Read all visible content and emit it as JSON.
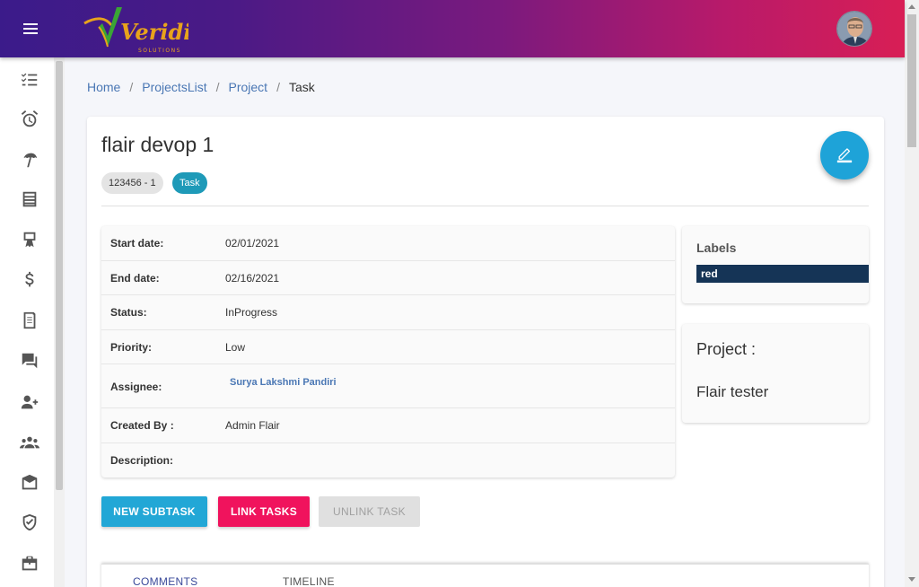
{
  "header": {
    "logo_text": "Veridic",
    "logo_subtext": "SOLUTIONS",
    "menu_icon": "hamburger-icon",
    "avatar_icon": "user-avatar"
  },
  "sidebar": {
    "items": [
      {
        "icon": "task-list-icon"
      },
      {
        "icon": "alarm-clock-icon"
      },
      {
        "icon": "umbrella-icon"
      },
      {
        "icon": "grid-list-icon"
      },
      {
        "icon": "certificate-icon"
      },
      {
        "icon": "dollar-icon"
      },
      {
        "icon": "document-icon"
      },
      {
        "icon": "chat-icon"
      },
      {
        "icon": "add-user-icon"
      },
      {
        "icon": "group-icon"
      },
      {
        "icon": "mail-box-icon"
      },
      {
        "icon": "shield-check-icon"
      },
      {
        "icon": "briefcase-icon"
      }
    ]
  },
  "breadcrumb": {
    "items": [
      "Home",
      "ProjectsList",
      "Project"
    ],
    "separator": "/",
    "current": "Task"
  },
  "task": {
    "title": "flair devop 1",
    "id_chip": "123456 - 1",
    "type_chip": "Task",
    "details": {
      "start_date_label": "Start date:",
      "start_date": "02/01/2021",
      "end_date_label": "End date:",
      "end_date": "02/16/2021",
      "status_label": "Status:",
      "status": "InProgress",
      "priority_label": "Priority:",
      "priority": "Low",
      "assignee_label": "Assignee:",
      "assignee": "Surya Lakshmi Pandiri",
      "created_by_label": "Created By :",
      "created_by": "Admin Flair",
      "description_label": "Description:"
    },
    "labels": {
      "heading": "Labels",
      "items": [
        "red"
      ]
    },
    "project": {
      "heading": "Project :",
      "name": "Flair tester"
    }
  },
  "actions": {
    "new_subtask": "NEW SUBTASK",
    "link_tasks": "LINK TASKS",
    "unlink_task": "UNLINK TASK"
  },
  "tabs": {
    "comments": "COMMENTS",
    "timeline": "TIMELINE"
  },
  "colors": {
    "header_start": "#3b1b8a",
    "header_end": "#d81e55",
    "primary": "#1ea3d8",
    "danger": "#f0135d",
    "label_red_bg": "#153456"
  }
}
